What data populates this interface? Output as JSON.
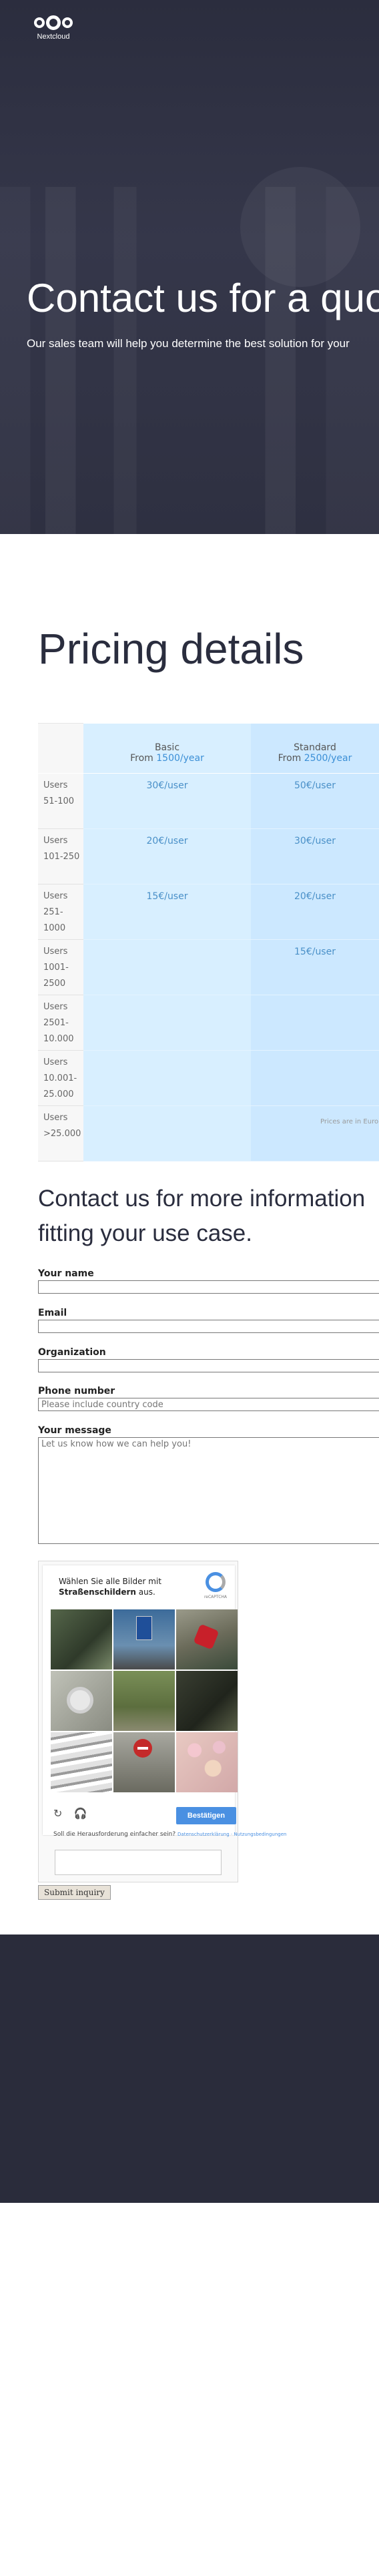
{
  "header": {
    "brand": "Nextcloud",
    "title": "Contact us for a quo",
    "subtitle": "Our sales team will help you determine the best solution for your"
  },
  "pricing": {
    "title": "Pricing details",
    "plans": [
      {
        "name": "Basic",
        "from_label": "From",
        "amount": "1500/year"
      },
      {
        "name": "Standard",
        "from_label": "From",
        "amount": "2500/year"
      }
    ],
    "rows": [
      {
        "users": "Users 51-100",
        "basic": "30€/user",
        "standard": "50€/user"
      },
      {
        "users": "Users 101-250",
        "basic": "20€/user",
        "standard": "30€/user"
      },
      {
        "users": "Users 251-1000",
        "basic": "15€/user",
        "standard": "20€/user"
      },
      {
        "users": "Users 1001-2500",
        "basic": "",
        "standard": "15€/user"
      },
      {
        "users": "Users 2501-10.000",
        "basic": "",
        "standard": ""
      },
      {
        "users": "Users 10.001-25.000",
        "basic": "",
        "standard": ""
      },
      {
        "users": "Users >25.000",
        "basic": "",
        "standard": ""
      }
    ],
    "note": "Prices are in Euro p"
  },
  "contact": {
    "title": "Contact us for more information fitting your use case.",
    "fields": {
      "name_label": "Your name",
      "email_label": "Email",
      "org_label": "Organization",
      "phone_label": "Phone number",
      "phone_placeholder": "Please include country code",
      "message_label": "Your message",
      "message_placeholder": "Let us know how we can help you!"
    },
    "submit_label": "Submit inquiry"
  },
  "captcha": {
    "instruction_prefix": "Wählen Sie alle Bilder mit",
    "instruction_target": "Straßenschildern",
    "instruction_suffix": "aus.",
    "logo_text": "reCAPTCHA",
    "reload_icon": "↻",
    "audio_icon": "🎧",
    "verify_label": "Bestätigen",
    "hint": "Soll die Herausforderung einfacher sein?",
    "hint_link": "Datenschutzerklärung · Nutzungsbedingungen"
  },
  "colors": {
    "hero_bg": "#2b2d3e",
    "basic_col": "#d8efff",
    "standard_col": "#cce8ff",
    "price_text": "#4a90c8",
    "verify_blue": "#4a90e2"
  }
}
